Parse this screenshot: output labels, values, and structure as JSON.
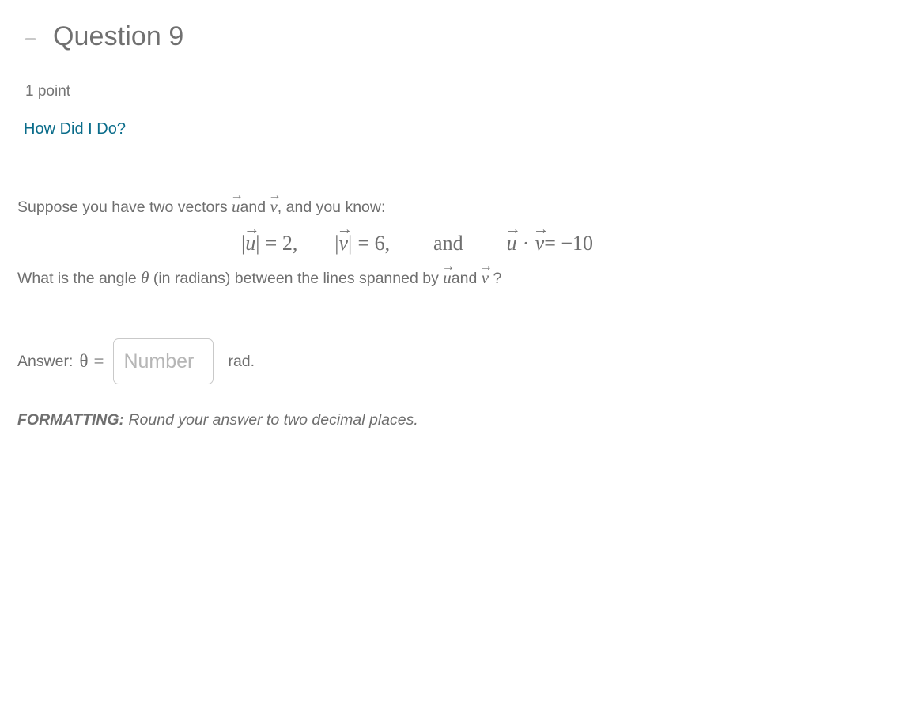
{
  "header": {
    "collapse_icon": "minus-icon",
    "title": "Question 9"
  },
  "meta": {
    "points": "1 point",
    "how_did_i_do_link": "How Did I Do?"
  },
  "prompt": {
    "intro_before": "Suppose you have two vectors",
    "intro_u": "u",
    "intro_and": "and",
    "intro_v": "v",
    "intro_after": ", and you know:"
  },
  "equation": {
    "norm_u_open": "|",
    "norm_u_var": "u",
    "norm_u_close": "|",
    "norm_u_eq": "= 2,",
    "norm_v_open": "|",
    "norm_v_var": "v",
    "norm_v_close": "|",
    "norm_v_eq": "= 6,",
    "conjunction": "and",
    "dot_u": "u",
    "dot_symbol": "·",
    "dot_v": "v",
    "dot_eq": "= −10"
  },
  "question": {
    "part1": "What is the angle",
    "theta": "θ",
    "part2": "(in radians) between the lines spanned by",
    "var_u": "u",
    "joiner": "and",
    "var_v": "v",
    "part3": "?"
  },
  "answer": {
    "label": "Answer:",
    "theta": "θ",
    "equals": "=",
    "input_value": "",
    "input_placeholder": "Number",
    "unit": "rad."
  },
  "formatting": {
    "label": "FORMATTING:",
    "text": "Round your answer to two decimal places."
  },
  "colors": {
    "text": "#6f6f6f",
    "link": "#0a6c8a",
    "border": "#c9c9c9",
    "placeholder": "#b6b6b6",
    "background": "#ffffff"
  },
  "arrow_glyph": "→"
}
